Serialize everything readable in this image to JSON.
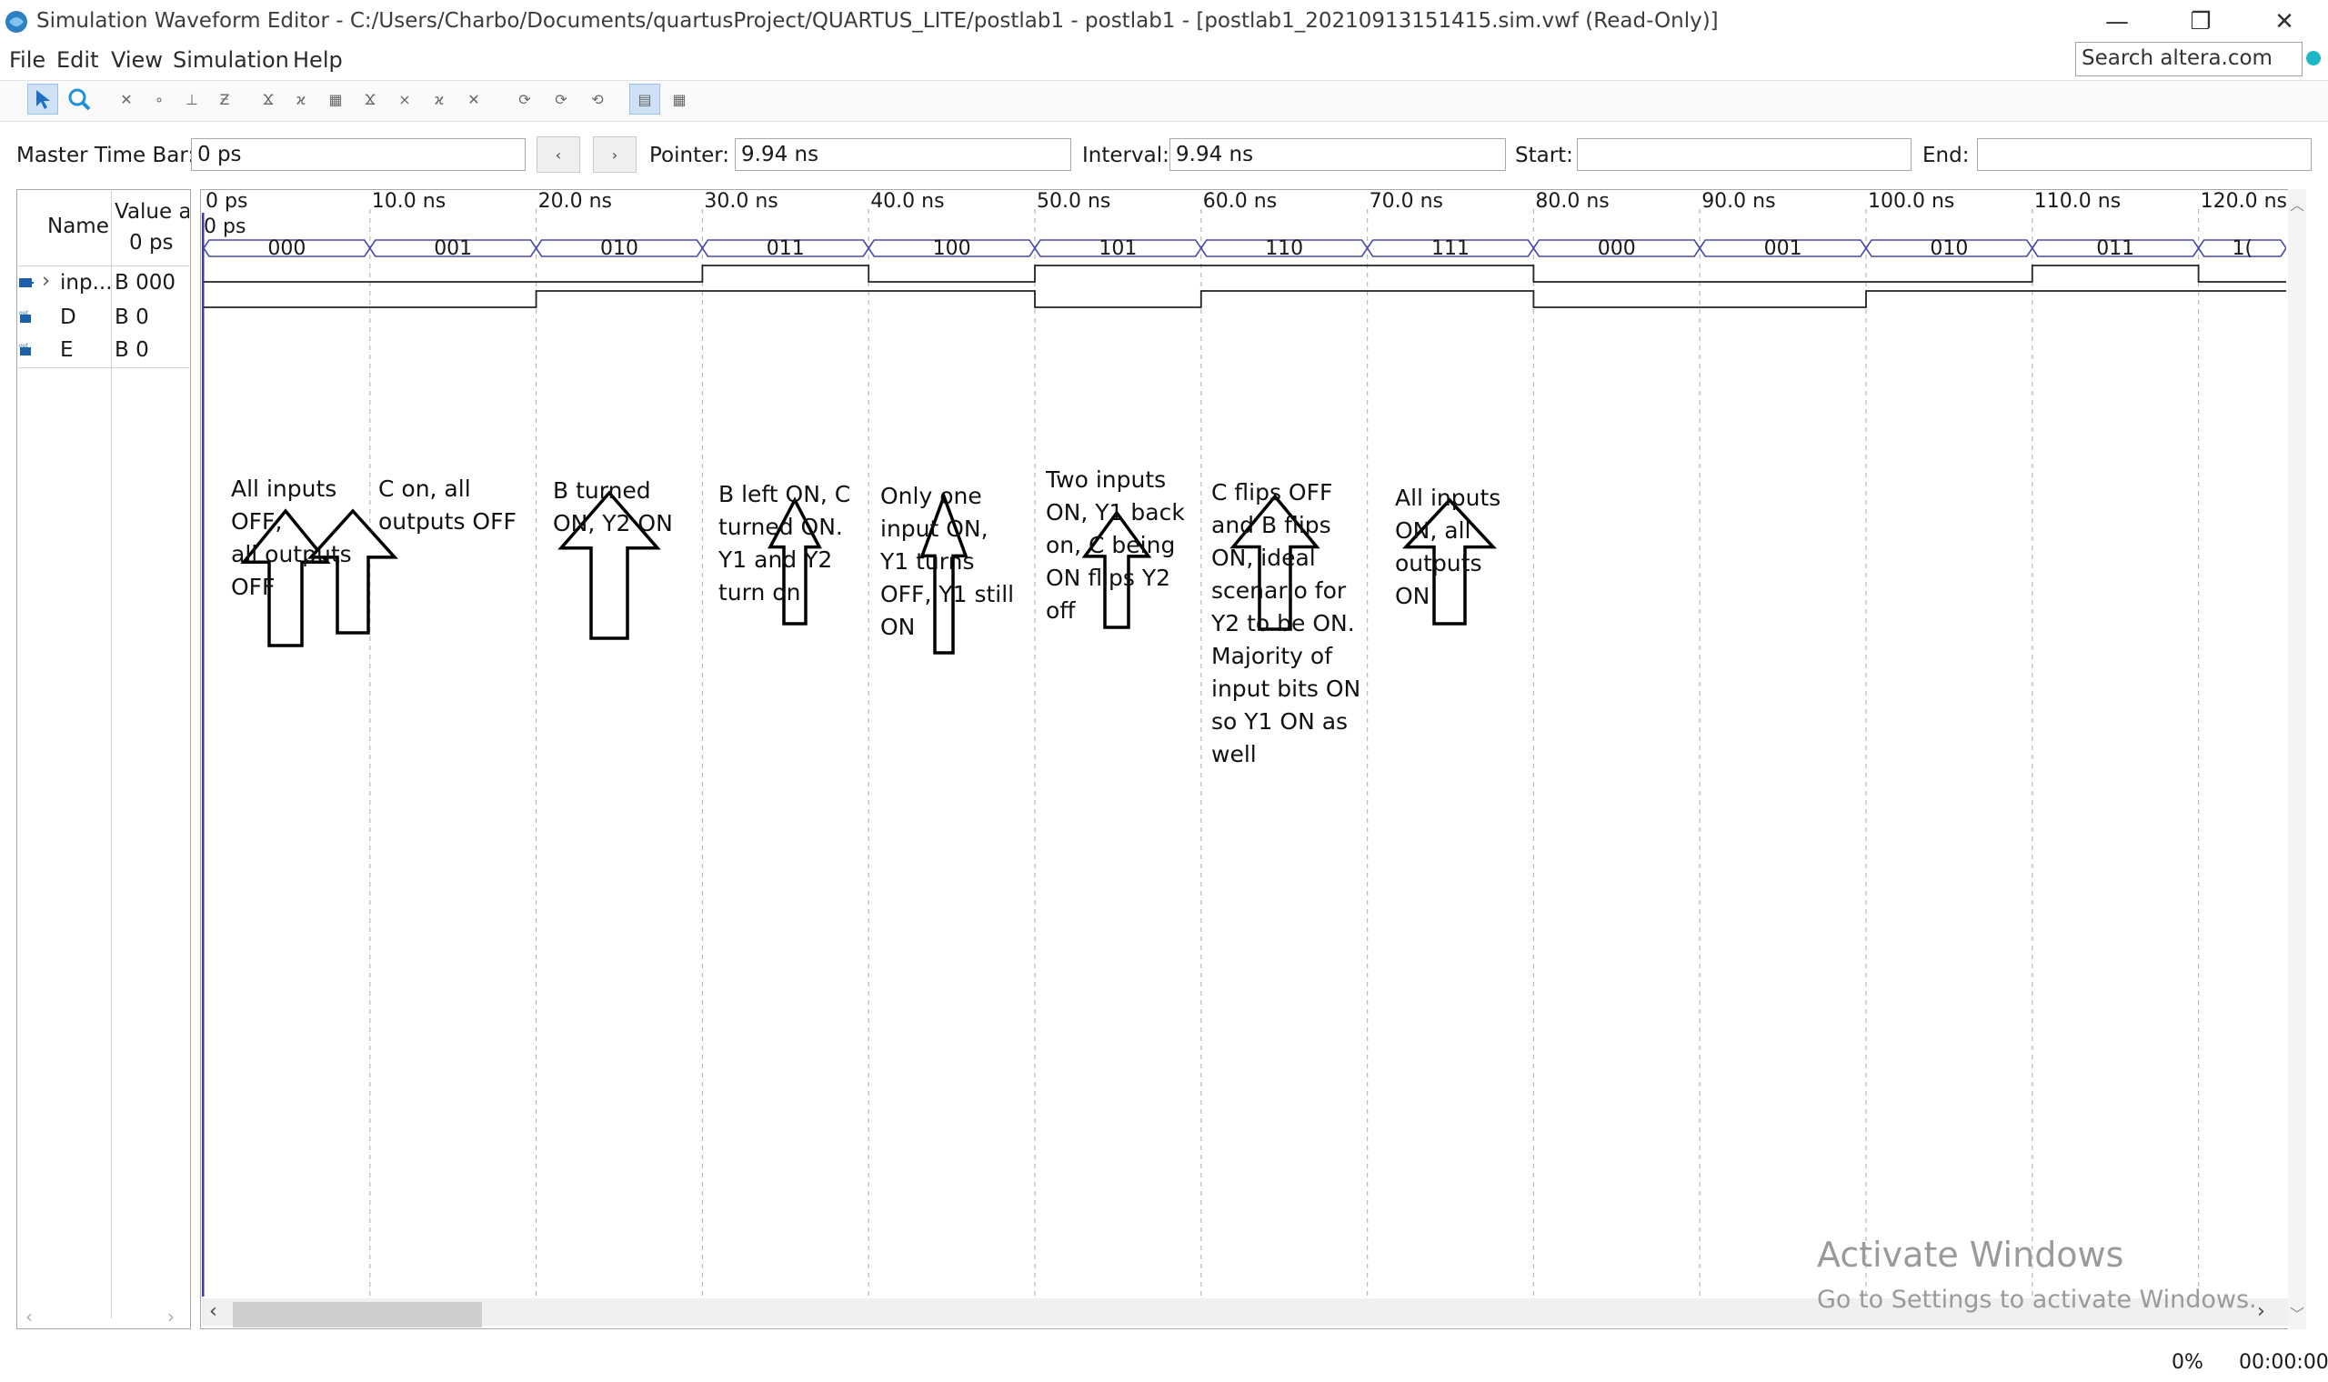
{
  "window": {
    "title": "Simulation Waveform Editor - C:/Users/Charbo/Documents/quartusProject/QUARTUS_LITE/postlab1 - postlab1 - [postlab1_20210913151415.sim.vwf (Read-Only)]",
    "minimize": "—",
    "restore": "❐",
    "close": "✕"
  },
  "menu": {
    "items": [
      "File",
      "Edit",
      "View",
      "Simulation",
      "Help"
    ],
    "search_placeholder": "Search altera.com"
  },
  "timebar": {
    "master_label": "Master Time Bar:",
    "master_value": "0 ps",
    "prev": "‹",
    "next": "›",
    "pointer_label": "Pointer:",
    "pointer_value": "9.94 ns",
    "interval_label": "Interval:",
    "interval_value": "9.94 ns",
    "start_label": "Start:",
    "start_value": "",
    "end_label": "End:",
    "end_value": ""
  },
  "signals": {
    "header_name": "Name",
    "header_value_1": "Value a",
    "header_value_2": "0 ps",
    "rows": [
      {
        "name": "inp...",
        "value": "B 000"
      },
      {
        "name": "D",
        "value": "B 0"
      },
      {
        "name": "E",
        "value": "B 0"
      }
    ]
  },
  "timeline": {
    "ticks": [
      "0 ps",
      "10.0 ns",
      "20.0 ns",
      "30.0 ns",
      "40.0 ns",
      "50.0 ns",
      "60.0 ns",
      "70.0 ns",
      "80.0 ns",
      "90.0 ns",
      "100.0 ns",
      "110.0 ns",
      "120.0 ns"
    ],
    "cursor_label": "0 ps",
    "bus_values": [
      "000",
      "001",
      "010",
      "011",
      "100",
      "101",
      "110",
      "111",
      "000",
      "001",
      "010",
      "011",
      "1("
    ],
    "d_levels": [
      0,
      0,
      0,
      1,
      0,
      1,
      1,
      1,
      0,
      0,
      0,
      1,
      0
    ],
    "e_levels": [
      0,
      0,
      1,
      1,
      1,
      0,
      1,
      1,
      0,
      0,
      1,
      1,
      1
    ]
  },
  "annotations": [
    {
      "lines": [
        "All inputs",
        "OFF,",
        "all outputs",
        "OFF"
      ]
    },
    {
      "lines": [
        "C on, all",
        "outputs OFF"
      ]
    },
    {
      "lines": [
        "B turned",
        "ON, Y2 ON"
      ]
    },
    {
      "lines": [
        "B left ON, C",
        "turned ON.",
        "Y1 and Y2",
        "turn on"
      ]
    },
    {
      "lines": [
        "Only one",
        "input ON,",
        "Y1 turns",
        "OFF, Y1 still",
        "ON"
      ]
    },
    {
      "lines": [
        "Two inputs",
        "ON, Y1 back",
        "on, C being",
        "ON flips Y2",
        "off"
      ]
    },
    {
      "lines": [
        "C flips OFF",
        "and B flips",
        "ON, ideal",
        "scenario for",
        "Y2 to be ON.",
        "Majority of",
        "input bits ON",
        "so Y1 ON as",
        "well"
      ]
    },
    {
      "lines": [
        "All inputs",
        "ON, all",
        "outputs",
        "ON"
      ]
    }
  ],
  "watermark": {
    "line1": "Activate Windows",
    "line2": "Go to Settings to activate Windows."
  },
  "status": {
    "progress": "0%",
    "elapsed": "00:00:00"
  },
  "colors": {
    "bus_line": "#4a4aa8",
    "cursor": "#3a3aa0",
    "grid": "#b8b8b8"
  }
}
